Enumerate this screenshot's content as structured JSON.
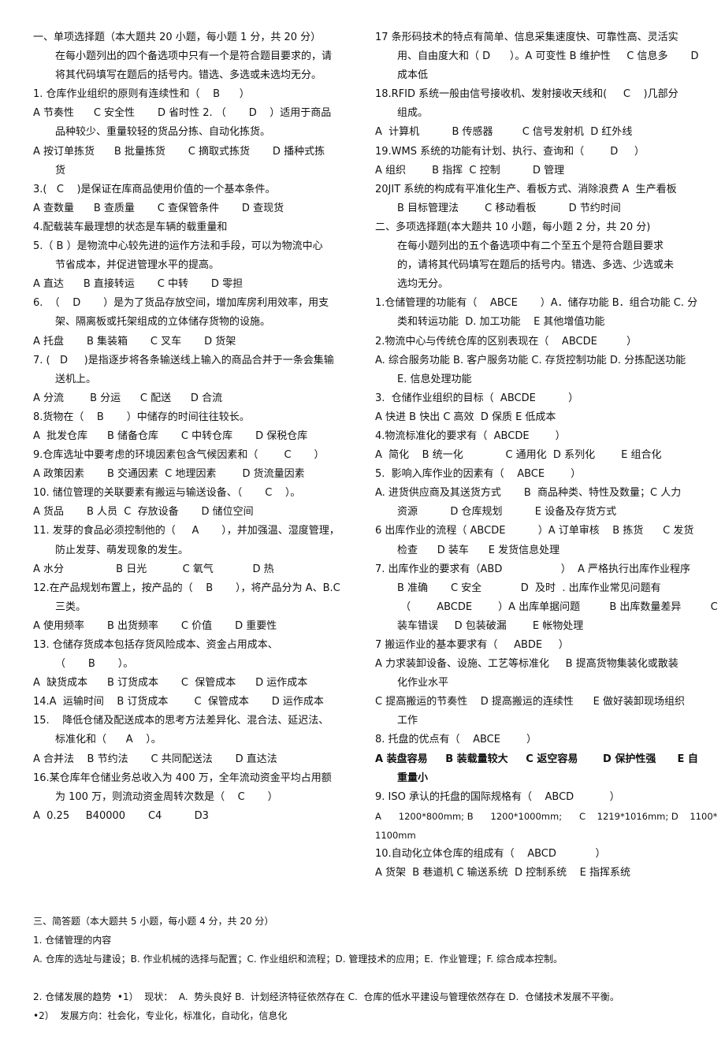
{
  "left": {
    "lines": [
      "一、单项选择题（本大题共 20 小题，每小题 1 分，共 20 分）",
      "在每小题列出的四个备选项中只有一个是符合题目要求的，请",
      "将其代码填写在题后的括号内。错选、多选或未选均无分。",
      "1. 仓库作业组织的原则有连续性和（    B      ）",
      "A 节奏性      C 安全性       D 省时性 2. （       D    ）适用于商品",
      "品种较少、重量较轻的货品分拣、自动化拣货。",
      "A 按订单拣货      B 批量拣货       C 摘取式拣货       D 播种式拣",
      "货",
      "3.(   C    )是保证在库商品使用价值的一个基本条件。",
      "A 查数量      B 查质量       C 查保管条件       D 查现货",
      "4.配载装车最理想的状态是车辆的载重量和",
      "5.（ B ）是物流中心较先进的运作方法和手段，可以为物流中心",
      "节省成本，并促进管理水平的提高。",
      "A 直达      B 直接转运       C 中转       D 零担",
      "6.  （    D       ）是为了货品存放空间，增加库房利用效率，用支",
      "架、隔离板或托架组成的立体储存货物的设施。",
      "A 托盘       B 集装箱       C 叉车       D 货架",
      "7. (   D     )是指逐步将各条输送线上输入的商品合并于一条会集输",
      "送机上。",
      "A 分流        B 分运      C 配送      D 合流",
      "8.货物在（    B       ）中储存的时间往往较长。",
      "A  批发仓库      B 储备仓库       C 中转仓库       D 保税仓库",
      "9.仓库选址中要考虑的环境因素包含气候因素和（        C       ）",
      "A 政策因素       B 交通因素  C 地理因素        D 货流量因素",
      "10. 储位管理的关联要素有搬运与输送设备、（       C    ）。",
      "A 货品       B 人员  C  存放设备       D 储位空间",
      "11. 发芽的食品必须控制他的（     A       ），并加强温、湿度管理，",
      "防止发芽、萌发现象的发生。",
      "A 水分                B 日光           C 氧气            D 热",
      "12.在产品规划布置上，按产品的（    B       ），将产品分为 A、B.C",
      "三类。",
      "A 使用频率       B 出货频率       C 价值       D 重要性",
      "13. 仓储存货成本包括存货风险成本、资金占用成本、",
      "（       B       ）。",
      "A  缺货成本      B 订货成本       C  保管成本      D 运作成本",
      "14.A  运输时间    B 订货成本        C  保管成本       D 运作成本",
      "15.    降低仓储及配送成本的思考方法差异化、混合法、延迟法、",
      "标准化和（      A    ）。",
      "A 合并法    B 节约法       C 共同配送法       D 直达法",
      "16.某仓库年仓储业务总收入为 400 万，全年流动资金平均占用额",
      "为 100 万，则流动资金周转次数是（    C       ）",
      "A  0.25     B40000       C4          D3"
    ]
  },
  "right": {
    "lines": [
      "17 条形码技术的特点有简单、信息采集速度快、可靠性高、灵活实",
      "用、自由度大和（ D      ）。A 可变性 B 维护性     C 信息多       D",
      "成本低",
      "18.RFID 系统一般由信号接收机、发射接收天线和(     C    )几部分",
      "组成。",
      "A  计算机          B 传感器         C 信号发射机  D 红外线",
      "19.WMS 系统的功能有计划、执行、查询和（        D     ）",
      "A 组织        B 指挥  C 控制          D 管理",
      "20JIT 系统的构成有平准化生产、看板方式、消除浪费 A  生产看板",
      "B 目标管理法        C 移动看板          D 节约时间",
      "二、多项选择题(本大题共 10 小题，每小题 2 分，共 20 分)",
      "在每小题列出的五个备选项中有二个至五个是符合题目要求",
      "的，请将其代码填写在题后的括号内。错选、多选、少选或未",
      "选均无分。",
      "1.仓储管理的功能有（    ABCE       ）A．储存功能 B．组合功能 C. 分",
      "类和转运功能  D. 加工功能    E 其他增值功能",
      "2.物流中心与传统仓库的区别表现在（    ABCDE         ）",
      "A. 综合服务功能 B. 客户服务功能 C. 存货控制功能 D. 分拣配送功能",
      "E. 信息处理功能",
      "3.  仓储作业组织的目标（  ABCDE          ）",
      "A 快进 B 快出 C 高效  D 保质 E 低成本",
      "4.物流标准化的要求有（  ABCDE        ）",
      "A  简化    B 统一化             C 通用化  D 系列化        E 组合化",
      "5.  影响入库作业的因素有（    ABCE        ）",
      "A. 进货供应商及其送货方式       B  商品种类、特性及数量；C 人力",
      "资源          D 仓库规划          E 设备及存货方式",
      "6 出库作业的流程（ ABCDE          ）A 订单审核    B 拣货      C 发货",
      "检查      D 装车      E 发货信息处理",
      "7. 出库作业的要求有（ABD                  ）  A 严格执行出库作业程序",
      "B 准确       C 安全            D  及时  . 出库作业常见问题有",
      " （        ABCDE        ）A 出库单据问题         B 出库数量差异         C",
      "装车错误     D 包装破漏        E 帐物处理",
      "7 搬运作业的基本要求有（     ABDE     ）",
      "A 力求装卸设备、设施、工艺等标准化     B 提高货物集装化或散装",
      "化作业水平",
      "C 提高搬运的节奏性    D 提高搬运的连续性      E 做好装卸现场组织",
      "工作",
      "8. 托盘的优点有（    ABCE        ）",
      "A 装盘容易     B 装载量较大     C 返空容易       D 保护性强      E 自",
      "重量小",
      "9. ISO 承认的托盘的国际规格有（    ABCD           ）",
      "A      1200*800mm; B      1200*1000mm;      C    1219*1016mm; D    1100*1100mm",
      "10.自动化立体仓库的组成有（    ABCD            ）",
      "A 货架  B 巷道机 C 输送系统  D 控制系统    E 指挥系统"
    ]
  },
  "bottom": {
    "lines": [
      "三、简答题（本大题共 5 小题，每小题 4 分，共 20 分）",
      "1. 仓储管理的内容",
      "A. 仓库的选址与建设；B. 作业机械的选择与配置；C. 作业组织和流程；D. 管理技术的应用；E.  作业管理；F. 综合成本控制。",
      "2. 仓储发展的趋势  •1）  现状：  A.  势头良好 B.  计划经济特征依然存在 C.  仓库的低水平建设与管理依然存在 D.  仓储技术发展不平衡。",
      "•2）  发展方向：社会化，专业化，标准化，自动化，信息化"
    ]
  }
}
